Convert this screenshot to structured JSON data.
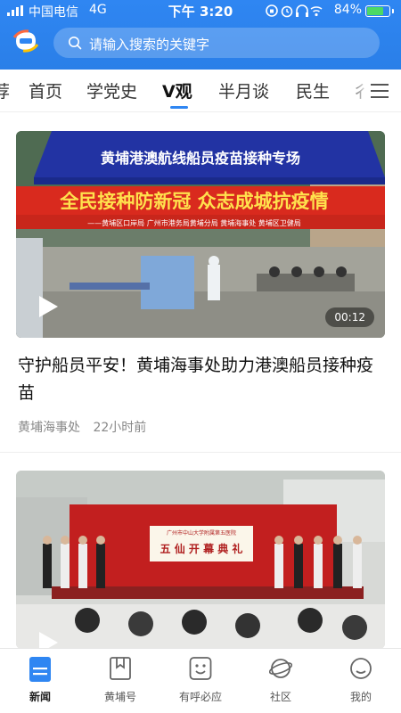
{
  "status_bar": {
    "carrier": "中国电信",
    "network": "4G",
    "time": "下午 3:20",
    "battery_percent": "84%",
    "battery_level": 0.84,
    "icons": [
      "rotation-lock-icon",
      "alarm-icon",
      "headphones-icon",
      "wifi-icon"
    ]
  },
  "header": {
    "logo_icon": "app-logo-icon",
    "search_placeholder": "请输入搜索的关键字",
    "accent_color": "#2f86f2"
  },
  "tabs": {
    "items": [
      {
        "label": "荐"
      },
      {
        "label": "首页"
      },
      {
        "label": "学党史"
      },
      {
        "label": "V观",
        "active": true
      },
      {
        "label": "半月谈"
      },
      {
        "label": "民生"
      },
      {
        "label": "彳"
      }
    ],
    "menu_icon": "hamburger-menu-icon"
  },
  "feed": {
    "items": [
      {
        "title": "守护船员平安！黄埔海事处助力港澳船员接种疫苗",
        "source": "黄埔海事处",
        "time_ago": "22小时前",
        "duration": "00:12",
        "image_text": {
          "tent_banner": "黄埔港澳航线船员疫苗接种专场",
          "slogan": "全民接种防新冠  众志成城抗疫情",
          "sponsors": "——黄埔区口岸局   广州市港务局黄埔分局   黄埔海事处   黄埔区卫健局"
        }
      },
      {
        "title": "",
        "image_text": {
          "board_top": "广州市中山大学附属第五医院",
          "board_main": "五 仙 开 幕 典 礼"
        }
      }
    ]
  },
  "bottom_nav": {
    "items": [
      {
        "label": "新闻",
        "icon": "news-icon",
        "active": true
      },
      {
        "label": "黄埔号",
        "icon": "bookmark-icon"
      },
      {
        "label": "有呼必应",
        "icon": "smile-face-icon"
      },
      {
        "label": "社区",
        "icon": "planet-icon"
      },
      {
        "label": "我的",
        "icon": "profile-icon"
      }
    ]
  }
}
